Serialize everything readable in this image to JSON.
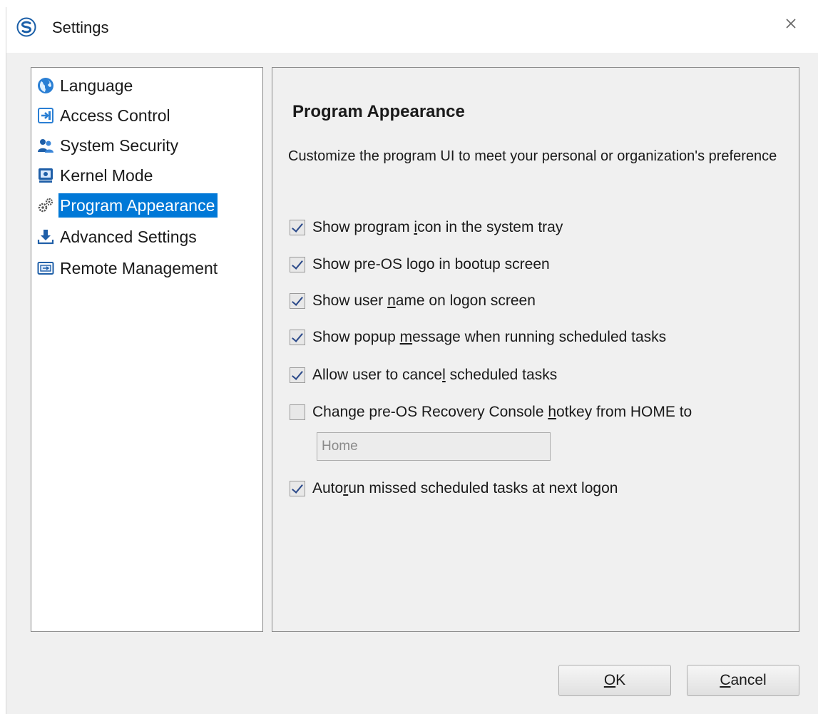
{
  "window": {
    "title": "Settings"
  },
  "nav": {
    "items": [
      {
        "label": "Language",
        "icon": "globe-icon"
      },
      {
        "label": "Access Control",
        "icon": "access-arrow-icon"
      },
      {
        "label": "System Security",
        "icon": "users-icon"
      },
      {
        "label": "Kernel Mode",
        "icon": "kernel-icon"
      },
      {
        "label": "Program Appearance",
        "icon": "gears-icon",
        "selected": true
      },
      {
        "label": "Advanced Settings",
        "icon": "download-arrow-icon"
      },
      {
        "label": "Remote Management",
        "icon": "remote-window-icon"
      }
    ]
  },
  "content": {
    "title": "Program Appearance",
    "description": "Customize the program UI to meet your personal or organization's preference",
    "options": [
      {
        "label_pre": "Show program ",
        "label_key": "i",
        "label_post": "con in the system tray",
        "checked": true
      },
      {
        "label_pre": "Show pre-OS lo",
        "label_key": "g",
        "label_post": "o in bootup screen",
        "checked": true
      },
      {
        "label_pre": "Show user ",
        "label_key": "n",
        "label_post": "ame on logon screen",
        "checked": true
      },
      {
        "label_pre": "Show popup ",
        "label_key": "m",
        "label_post": "essage when running scheduled tasks",
        "checked": true
      },
      {
        "label_pre": "Allow user to cance",
        "label_key": "l",
        "label_post": " scheduled tasks",
        "checked": true
      },
      {
        "label_pre": "Change pre-OS Recovery Console ",
        "label_key": "h",
        "label_post": "otkey from HOME to",
        "checked": false
      },
      {
        "label_pre": "Auto",
        "label_key": "r",
        "label_post": "un missed scheduled tasks at next logon",
        "checked": true
      }
    ],
    "hotkey_value": "Home"
  },
  "buttons": {
    "ok_key": "O",
    "ok_rest": "K",
    "cancel_key": "C",
    "cancel_rest": "ancel"
  },
  "colors": {
    "selection": "#0078d7",
    "panel_bg": "#f0f0f0"
  }
}
